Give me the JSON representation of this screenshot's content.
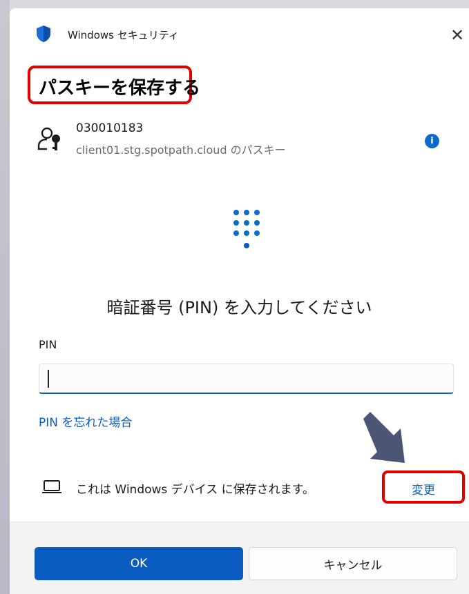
{
  "window": {
    "title": "Windows セキュリティ",
    "close_icon": "close-icon"
  },
  "dialog": {
    "heading": "パスキーを保存する"
  },
  "account": {
    "name": "030010183",
    "subtitle": "client01.stg.spotpath.cloud のパスキー",
    "info_icon_glyph": "i"
  },
  "pin": {
    "prompt": "暗証番号 (PIN) を入力してください",
    "label": "PIN",
    "value": "",
    "placeholder": "",
    "forgot_link": "PIN を忘れた場合"
  },
  "device": {
    "text": "これは Windows デバイス に保存されます。",
    "change_link": "変更"
  },
  "buttons": {
    "ok": "OK",
    "cancel": "キャンセル"
  },
  "colors": {
    "accent": "#0b5cc1",
    "highlight_border": "#e00000",
    "annotation_arrow": "#4a5673"
  }
}
